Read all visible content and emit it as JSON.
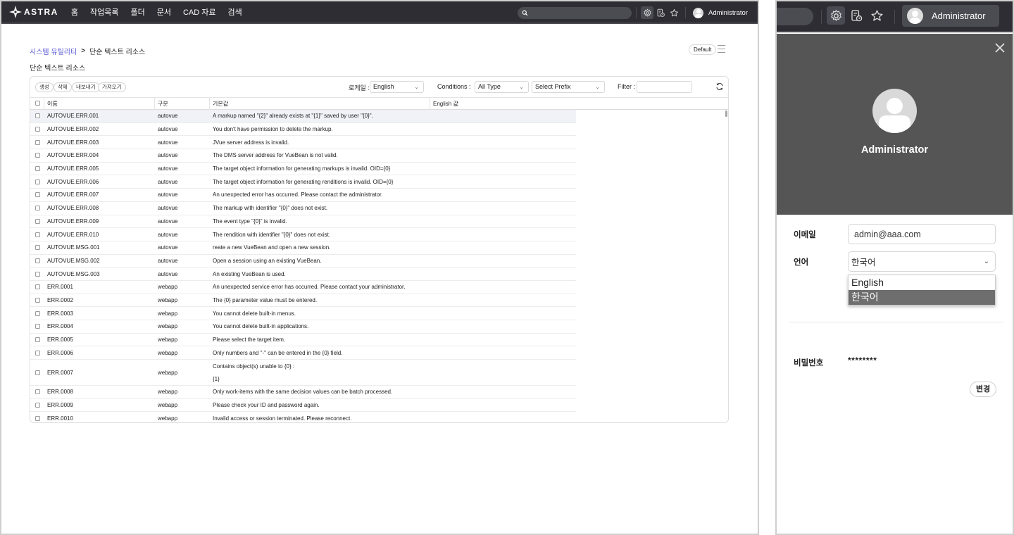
{
  "app": {
    "logo_text": "ASTRA",
    "nav": [
      "홈",
      "작업목록",
      "폴더",
      "문서",
      "CAD 자료",
      "검색"
    ],
    "search_placeholder": "",
    "user_name": "Administrator",
    "icons": [
      "search-icon",
      "settings-gear-icon",
      "document-clock-icon",
      "star-icon",
      "user-avatar-icon"
    ]
  },
  "breadcrumb": {
    "parent": "시스템 유틸리티",
    "separator": ">",
    "current": "단순 텍스트 리소스"
  },
  "page_title": "단순 텍스트 리소스",
  "view_button": "Default",
  "toolbar": {
    "buttons": [
      "생성",
      "삭제",
      "내보내기",
      "가져오기"
    ],
    "locale_label": "로케일 :",
    "locale_value": "English",
    "conditions_label": "Conditions :",
    "type_value": "All Type",
    "prefix_value": "Select Prefix",
    "filter_label": "Filter :",
    "filter_value": ""
  },
  "table": {
    "columns": [
      "이름",
      "구분",
      "기본값",
      "English 값"
    ],
    "rows": [
      {
        "name": "AUTOVUE.ERR.001",
        "category": "autovue",
        "default": "A markup named \"{2}\" already exists at \"{1}\" saved by user \"{0}\".",
        "english": ""
      },
      {
        "name": "AUTOVUE.ERR.002",
        "category": "autovue",
        "default": "You don't have permission to delete the markup.",
        "english": ""
      },
      {
        "name": "AUTOVUE.ERR.003",
        "category": "autovue",
        "default": "JVue server address is invalid.",
        "english": ""
      },
      {
        "name": "AUTOVUE.ERR.004",
        "category": "autovue",
        "default": "The DMS server address for VueBean is not valid.",
        "english": ""
      },
      {
        "name": "AUTOVUE.ERR.005",
        "category": "autovue",
        "default": "The target object information for generating markups is invalid. OID={0}",
        "english": ""
      },
      {
        "name": "AUTOVUE.ERR.006",
        "category": "autovue",
        "default": "The target object information for generating renditions is invalid. OID={0}",
        "english": ""
      },
      {
        "name": "AUTOVUE.ERR.007",
        "category": "autovue",
        "default": "An unexpected error has occurred. Please contact the administrator.",
        "english": ""
      },
      {
        "name": "AUTOVUE.ERR.008",
        "category": "autovue",
        "default": "The markup with identifier \"{0}\" does not exist.",
        "english": ""
      },
      {
        "name": "AUTOVUE.ERR.009",
        "category": "autovue",
        "default": "The event type \"{0}\" is invalid.",
        "english": ""
      },
      {
        "name": "AUTOVUE.ERR.010",
        "category": "autovue",
        "default": "The rendition with identifier \"{0}\" does not exist.",
        "english": ""
      },
      {
        "name": "AUTOVUE.MSG.001",
        "category": "autovue",
        "default": "reate a new VueBean and open a new session.",
        "english": ""
      },
      {
        "name": "AUTOVUE.MSG.002",
        "category": "autovue",
        "default": "Open a session using an existing VueBean.",
        "english": ""
      },
      {
        "name": "AUTOVUE.MSG.003",
        "category": "autovue",
        "default": "An existing VueBean is used.",
        "english": ""
      },
      {
        "name": "ERR.0001",
        "category": "webapp",
        "default": "An unexpected service error has occurred. Please contact your administrator.",
        "english": ""
      },
      {
        "name": "ERR.0002",
        "category": "webapp",
        "default": "The {0} parameter value must be entered.",
        "english": ""
      },
      {
        "name": "ERR.0003",
        "category": "webapp",
        "default": "You cannot delete built-in menus.",
        "english": ""
      },
      {
        "name": "ERR.0004",
        "category": "webapp",
        "default": "You cannot delete built-in applications.",
        "english": ""
      },
      {
        "name": "ERR.0005",
        "category": "webapp",
        "default": "Please select the target item.",
        "english": ""
      },
      {
        "name": "ERR.0006",
        "category": "webapp",
        "default": "Only numbers and \"-\" can be entered in the {0} field.",
        "english": ""
      },
      {
        "name": "ERR.0007",
        "category": "webapp",
        "default": "Contains object(s) unable to {0} :",
        "default_line2": "{1}",
        "english": ""
      },
      {
        "name": "ERR.0008",
        "category": "webapp",
        "default": "Only work-items with the same decision values can be batch processed.",
        "english": ""
      },
      {
        "name": "ERR.0009",
        "category": "webapp",
        "default": "Please check your ID and password again.",
        "english": ""
      },
      {
        "name": "ERR.0010",
        "category": "webapp",
        "default": "Invalid access or session terminated. Please reconnect.",
        "english": ""
      }
    ]
  },
  "profile": {
    "user_name": "Administrator",
    "email_label": "이메일",
    "email_value": "admin@aaa.com",
    "language_label": "언어",
    "language_value": "한국어",
    "language_options": [
      "English",
      "한국어"
    ],
    "language_selected_index": 1,
    "password_label": "비밀번호",
    "password_value": "********",
    "change_button": "변경"
  },
  "colors": {
    "topbar_bg": "#2d2d33",
    "breadcrumb_link": "#5a5ad6",
    "profile_header_bg": "#555555",
    "selected_option_bg": "#6e6e6e",
    "selected_row_bg": "#f1f2f8"
  }
}
